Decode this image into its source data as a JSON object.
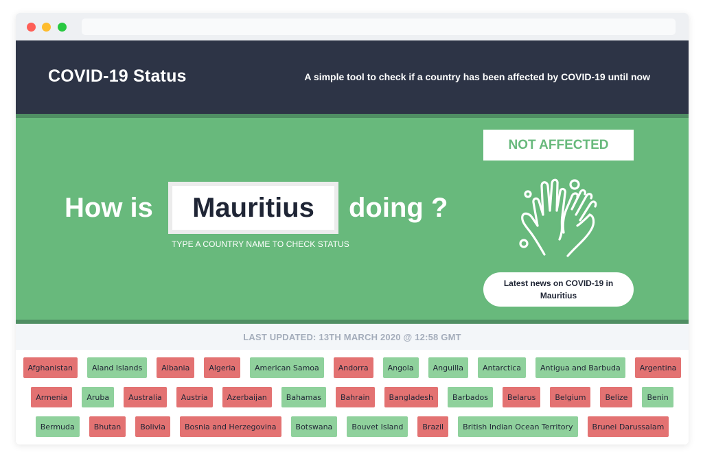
{
  "header": {
    "title": "COVID-19 Status",
    "tagline": "A simple tool to check if a country has been affected by COVID-19 until now"
  },
  "hero": {
    "prefix": "How is",
    "country_value": "Mauritius",
    "suffix": "doing ?",
    "hint": "TYPE A COUNTRY NAME TO CHECK STATUS",
    "status": "NOT AFFECTED",
    "news_button": "Latest news on COVID-19 in Mauritius",
    "icon": "hand-washing-icon"
  },
  "last_updated": "LAST UPDATED: 13TH MARCH 2020 @ 12:58 GMT",
  "colors": {
    "header_bg": "#2d3446",
    "hero_bg": "#68b97c",
    "affected": "#e37272",
    "not_affected": "#8fd19c"
  },
  "countries": [
    [
      {
        "name": "Afghanistan",
        "affected": true
      },
      {
        "name": "Aland Islands",
        "affected": false
      },
      {
        "name": "Albania",
        "affected": true
      },
      {
        "name": "Algeria",
        "affected": true
      },
      {
        "name": "American Samoa",
        "affected": false
      },
      {
        "name": "Andorra",
        "affected": true
      },
      {
        "name": "Angola",
        "affected": false
      },
      {
        "name": "Anguilla",
        "affected": false
      },
      {
        "name": "Antarctica",
        "affected": false
      },
      {
        "name": "Antigua and Barbuda",
        "affected": false
      },
      {
        "name": "Argentina",
        "affected": true
      }
    ],
    [
      {
        "name": "Armenia",
        "affected": true
      },
      {
        "name": "Aruba",
        "affected": false
      },
      {
        "name": "Australia",
        "affected": true
      },
      {
        "name": "Austria",
        "affected": true
      },
      {
        "name": "Azerbaijan",
        "affected": true
      },
      {
        "name": "Bahamas",
        "affected": false
      },
      {
        "name": "Bahrain",
        "affected": true
      },
      {
        "name": "Bangladesh",
        "affected": true
      },
      {
        "name": "Barbados",
        "affected": false
      },
      {
        "name": "Belarus",
        "affected": true
      },
      {
        "name": "Belgium",
        "affected": true
      },
      {
        "name": "Belize",
        "affected": true
      },
      {
        "name": "Benin",
        "affected": false
      }
    ],
    [
      {
        "name": "Bermuda",
        "affected": false
      },
      {
        "name": "Bhutan",
        "affected": true
      },
      {
        "name": "Bolivia",
        "affected": true
      },
      {
        "name": "Bosnia and Herzegovina",
        "affected": true
      },
      {
        "name": "Botswana",
        "affected": false
      },
      {
        "name": "Bouvet Island",
        "affected": false
      },
      {
        "name": "Brazil",
        "affected": true
      },
      {
        "name": "British Indian Ocean Territory",
        "affected": false
      },
      {
        "name": "Brunei Darussalam",
        "affected": true
      }
    ]
  ]
}
